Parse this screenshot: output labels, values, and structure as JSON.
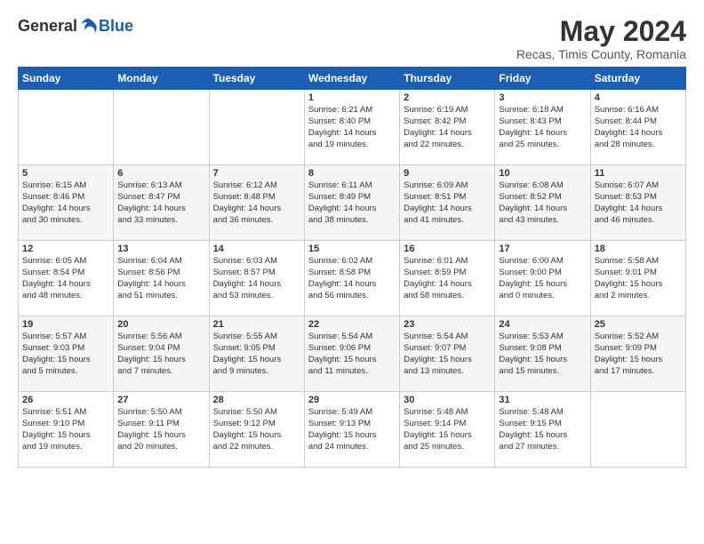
{
  "logo": {
    "general": "General",
    "blue": "Blue"
  },
  "title": {
    "month_year": "May 2024",
    "location": "Recas, Timis County, Romania"
  },
  "header": {
    "days": [
      "Sunday",
      "Monday",
      "Tuesday",
      "Wednesday",
      "Thursday",
      "Friday",
      "Saturday"
    ]
  },
  "weeks": [
    {
      "cells": [
        {
          "day": null,
          "info": null
        },
        {
          "day": null,
          "info": null
        },
        {
          "day": null,
          "info": null
        },
        {
          "day": "1",
          "info": "Sunrise: 6:21 AM\nSunset: 8:40 PM\nDaylight: 14 hours\nand 19 minutes."
        },
        {
          "day": "2",
          "info": "Sunrise: 6:19 AM\nSunset: 8:42 PM\nDaylight: 14 hours\nand 22 minutes."
        },
        {
          "day": "3",
          "info": "Sunrise: 6:18 AM\nSunset: 8:43 PM\nDaylight: 14 hours\nand 25 minutes."
        },
        {
          "day": "4",
          "info": "Sunrise: 6:16 AM\nSunset: 8:44 PM\nDaylight: 14 hours\nand 28 minutes."
        }
      ]
    },
    {
      "cells": [
        {
          "day": "5",
          "info": "Sunrise: 6:15 AM\nSunset: 8:46 PM\nDaylight: 14 hours\nand 30 minutes."
        },
        {
          "day": "6",
          "info": "Sunrise: 6:13 AM\nSunset: 8:47 PM\nDaylight: 14 hours\nand 33 minutes."
        },
        {
          "day": "7",
          "info": "Sunrise: 6:12 AM\nSunset: 8:48 PM\nDaylight: 14 hours\nand 36 minutes."
        },
        {
          "day": "8",
          "info": "Sunrise: 6:11 AM\nSunset: 8:49 PM\nDaylight: 14 hours\nand 38 minutes."
        },
        {
          "day": "9",
          "info": "Sunrise: 6:09 AM\nSunset: 8:51 PM\nDaylight: 14 hours\nand 41 minutes."
        },
        {
          "day": "10",
          "info": "Sunrise: 6:08 AM\nSunset: 8:52 PM\nDaylight: 14 hours\nand 43 minutes."
        },
        {
          "day": "11",
          "info": "Sunrise: 6:07 AM\nSunset: 8:53 PM\nDaylight: 14 hours\nand 46 minutes."
        }
      ]
    },
    {
      "cells": [
        {
          "day": "12",
          "info": "Sunrise: 6:05 AM\nSunset: 8:54 PM\nDaylight: 14 hours\nand 48 minutes."
        },
        {
          "day": "13",
          "info": "Sunrise: 6:04 AM\nSunset: 8:56 PM\nDaylight: 14 hours\nand 51 minutes."
        },
        {
          "day": "14",
          "info": "Sunrise: 6:03 AM\nSunset: 8:57 PM\nDaylight: 14 hours\nand 53 minutes."
        },
        {
          "day": "15",
          "info": "Sunrise: 6:02 AM\nSunset: 8:58 PM\nDaylight: 14 hours\nand 56 minutes."
        },
        {
          "day": "16",
          "info": "Sunrise: 6:01 AM\nSunset: 8:59 PM\nDaylight: 14 hours\nand 58 minutes."
        },
        {
          "day": "17",
          "info": "Sunrise: 6:00 AM\nSunset: 9:00 PM\nDaylight: 15 hours\nand 0 minutes."
        },
        {
          "day": "18",
          "info": "Sunrise: 5:58 AM\nSunset: 9:01 PM\nDaylight: 15 hours\nand 2 minutes."
        }
      ]
    },
    {
      "cells": [
        {
          "day": "19",
          "info": "Sunrise: 5:57 AM\nSunset: 9:03 PM\nDaylight: 15 hours\nand 5 minutes."
        },
        {
          "day": "20",
          "info": "Sunrise: 5:56 AM\nSunset: 9:04 PM\nDaylight: 15 hours\nand 7 minutes."
        },
        {
          "day": "21",
          "info": "Sunrise: 5:55 AM\nSunset: 9:05 PM\nDaylight: 15 hours\nand 9 minutes."
        },
        {
          "day": "22",
          "info": "Sunrise: 5:54 AM\nSunset: 9:06 PM\nDaylight: 15 hours\nand 11 minutes."
        },
        {
          "day": "23",
          "info": "Sunrise: 5:54 AM\nSunset: 9:07 PM\nDaylight: 15 hours\nand 13 minutes."
        },
        {
          "day": "24",
          "info": "Sunrise: 5:53 AM\nSunset: 9:08 PM\nDaylight: 15 hours\nand 15 minutes."
        },
        {
          "day": "25",
          "info": "Sunrise: 5:52 AM\nSunset: 9:09 PM\nDaylight: 15 hours\nand 17 minutes."
        }
      ]
    },
    {
      "cells": [
        {
          "day": "26",
          "info": "Sunrise: 5:51 AM\nSunset: 9:10 PM\nDaylight: 15 hours\nand 19 minutes."
        },
        {
          "day": "27",
          "info": "Sunrise: 5:50 AM\nSunset: 9:11 PM\nDaylight: 15 hours\nand 20 minutes."
        },
        {
          "day": "28",
          "info": "Sunrise: 5:50 AM\nSunset: 9:12 PM\nDaylight: 15 hours\nand 22 minutes."
        },
        {
          "day": "29",
          "info": "Sunrise: 5:49 AM\nSunset: 9:13 PM\nDaylight: 15 hours\nand 24 minutes."
        },
        {
          "day": "30",
          "info": "Sunrise: 5:48 AM\nSunset: 9:14 PM\nDaylight: 15 hours\nand 25 minutes."
        },
        {
          "day": "31",
          "info": "Sunrise: 5:48 AM\nSunset: 9:15 PM\nDaylight: 15 hours\nand 27 minutes."
        },
        {
          "day": null,
          "info": null
        }
      ]
    }
  ]
}
